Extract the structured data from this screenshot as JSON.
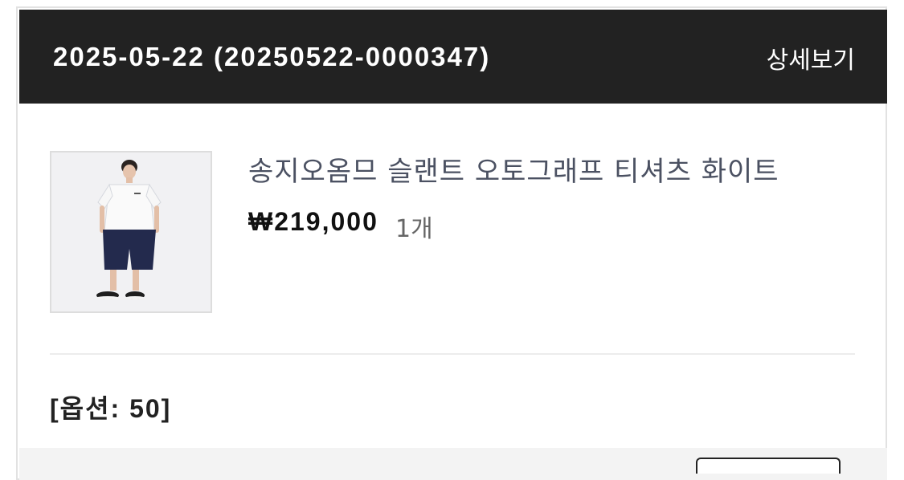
{
  "order": {
    "title": "2025-05-22 (20250522-0000347)",
    "detail_label": "상세보기"
  },
  "product": {
    "name": "송지오옴므 슬랜트 오토그래프 티셔츠 화이트",
    "price": "₩219,000",
    "quantity": "1개",
    "option": "[옵션: 50]"
  },
  "colors": {
    "header_bg": "#222222",
    "product_name": "#4b5162"
  }
}
